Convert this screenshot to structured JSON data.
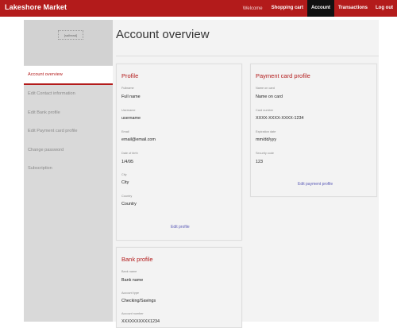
{
  "header": {
    "brand": "Lakeshore Market",
    "welcome": "Welcome",
    "nav": [
      "Shopping cart",
      "Account",
      "Transactions",
      "Log out"
    ]
  },
  "sidebar": {
    "logo_alt": "[salhead]",
    "items": [
      {
        "label": "Account overview",
        "active": true
      },
      {
        "label": "Edit Contact information"
      },
      {
        "label": "Edit Bank profile"
      },
      {
        "label": "Edit Payment card profile"
      },
      {
        "label": "Change password"
      },
      {
        "label": "Subscription"
      }
    ]
  },
  "main": {
    "title": "Account overview",
    "profile": {
      "title": "Profile",
      "fields": [
        {
          "label": "Fullname",
          "value": "Full name"
        },
        {
          "label": "Username",
          "value": "username"
        },
        {
          "label": "Email",
          "value": "email@email.com"
        },
        {
          "label": "Date of birth",
          "value": "1/4/95"
        },
        {
          "label": "City",
          "value": "City"
        },
        {
          "label": "Country",
          "value": "Country"
        }
      ],
      "edit_label": "Edit profile"
    },
    "payment": {
      "title": "Payment card profile",
      "fields": [
        {
          "label": "Name on card",
          "value": "Name on card"
        },
        {
          "label": "Card number",
          "value": "XXXX-XXXX-XXXX-1234"
        },
        {
          "label": "Expiration date",
          "value": "mm/dd/yyy"
        },
        {
          "label": "Security code",
          "value": "123"
        }
      ],
      "edit_label": "Edit payment profile"
    },
    "bank": {
      "title": "Bank profile",
      "fields": [
        {
          "label": "Bank name",
          "value": "Bank name"
        },
        {
          "label": "Account type",
          "value": "Checking/Savings"
        },
        {
          "label": "Account number",
          "value": "XXXXXXXXXX1234"
        }
      ]
    }
  },
  "colors": {
    "brand": "#b31b1b",
    "active_nav": "#111111",
    "link": "#5b5bb7"
  }
}
